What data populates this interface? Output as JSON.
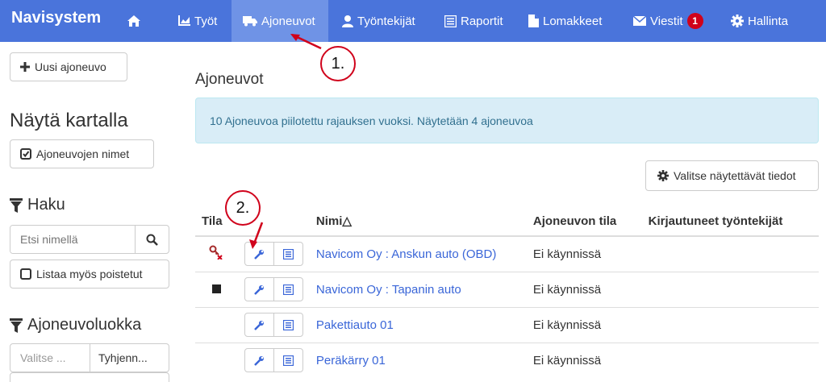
{
  "navbar": {
    "brand": "Navisystem",
    "items": [
      {
        "label": "Työt",
        "icon": "chart-icon"
      },
      {
        "label": "Ajoneuvot",
        "icon": "truck-icon",
        "active": true
      },
      {
        "label": "Työntekijät",
        "icon": "user-icon"
      },
      {
        "label": "Raportit",
        "icon": "report-icon"
      },
      {
        "label": "Lomakkeet",
        "icon": "file-icon"
      },
      {
        "label": "Viestit",
        "icon": "envelope-icon",
        "badge": "1"
      },
      {
        "label": "Hallinta",
        "icon": "gear-icon"
      }
    ]
  },
  "sidebar": {
    "new_vehicle": "Uusi ajoneuvo",
    "map_heading": "Näytä kartalla",
    "vehicle_names": "Ajoneuvojen nimet",
    "search_heading": "Haku",
    "search_placeholder": "Etsi nimellä",
    "list_deleted": "Listaa myös poistetut",
    "class_heading": "Ajoneuvoluokka",
    "class_select": "Valitse ...",
    "class_clear": "Tyhjenn..."
  },
  "main": {
    "title": "Ajoneuvot",
    "alert": "10 Ajoneuvoa piilotettu rajauksen vuoksi. Näytetään 4 ajoneuvoa",
    "select_fields": "Valitse näytettävät tiedot",
    "columns": [
      "Tila",
      "Nimi△",
      "Ajoneuvon tila",
      "Kirjautuneet työntekijät"
    ],
    "rows": [
      {
        "status": "key-x-icon",
        "name": "Navicom Oy : Anskun auto (OBD)",
        "state": "Ei käynnissä",
        "employees": ""
      },
      {
        "status": "stop-icon",
        "name": "Navicom Oy : Tapanin auto",
        "state": "Ei käynnissä",
        "employees": ""
      },
      {
        "status": "",
        "name": "Pakettiauto 01",
        "state": "Ei käynnissä",
        "employees": ""
      },
      {
        "status": "",
        "name": "Peräkärry 01",
        "state": "Ei käynnissä",
        "employees": ""
      }
    ]
  },
  "annotations": {
    "callout1": "1.",
    "callout2": "2."
  },
  "colors": {
    "navbar": "#4a74db",
    "active_tab": "#6f93e6",
    "link": "#3a66d8",
    "alert_bg": "#d9edf7",
    "annotation": "#d0021b"
  }
}
